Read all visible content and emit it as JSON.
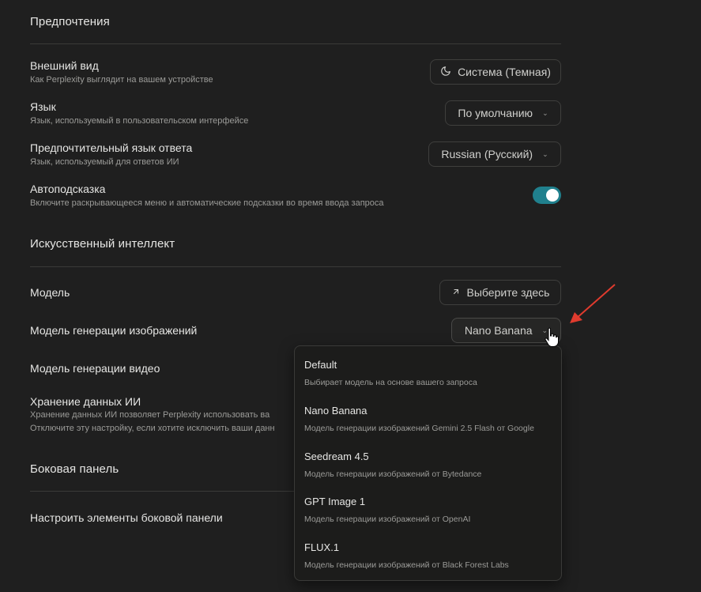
{
  "preferences": {
    "title": "Предпочтения",
    "appearance": {
      "title": "Внешний вид",
      "desc": "Как Perplexity выглядит на вашем устройстве",
      "value": "Система (Темная)",
      "icon": "moon-icon"
    },
    "language": {
      "title": "Язык",
      "desc": "Язык, используемый в пользовательском интерфейсе",
      "value": "По умолчанию"
    },
    "response_language": {
      "title": "Предпочтительный язык ответа",
      "desc": "Язык, используемый для ответов ИИ",
      "value": "Russian (Русский)"
    },
    "autosuggest": {
      "title": "Автоподсказка",
      "desc": "Включите раскрывающееся меню и автоматические подсказки во время ввода запроса",
      "enabled": true
    }
  },
  "ai": {
    "title": "Искусственный интеллект",
    "model": {
      "title": "Модель",
      "button": "Выберите здесь",
      "icon": "arrow-up-right-icon"
    },
    "image_model": {
      "title": "Модель генерации изображений",
      "value": "Nano Banana"
    },
    "video_model": {
      "title": "Модель генерации видео"
    },
    "data_retention": {
      "title": "Хранение данных ИИ",
      "desc1": "Хранение данных ИИ позволяет Perplexity использовать ва",
      "desc2": "Отключите эту настройку, если хотите исключить ваши данн"
    }
  },
  "sidebar": {
    "title": "Боковая панель",
    "customize": {
      "title": "Настроить элементы боковой панели"
    }
  },
  "dropdown": {
    "options": [
      {
        "title": "Default",
        "desc": "Выбирает модель на основе вашего запроса"
      },
      {
        "title": "Nano Banana",
        "desc": "Модель генерации изображений Gemini 2.5 Flash от Google"
      },
      {
        "title": "Seedream 4.5",
        "desc": "Модель генерации изображений от Bytedance"
      },
      {
        "title": "GPT Image 1",
        "desc": "Модель генерации изображений от OpenAI"
      },
      {
        "title": "FLUX.1",
        "desc": "Модель генерации изображений от Black Forest Labs"
      }
    ]
  },
  "colors": {
    "accent": "#20808d",
    "background": "#1f1f1f",
    "arrow": "#e03b2e"
  }
}
